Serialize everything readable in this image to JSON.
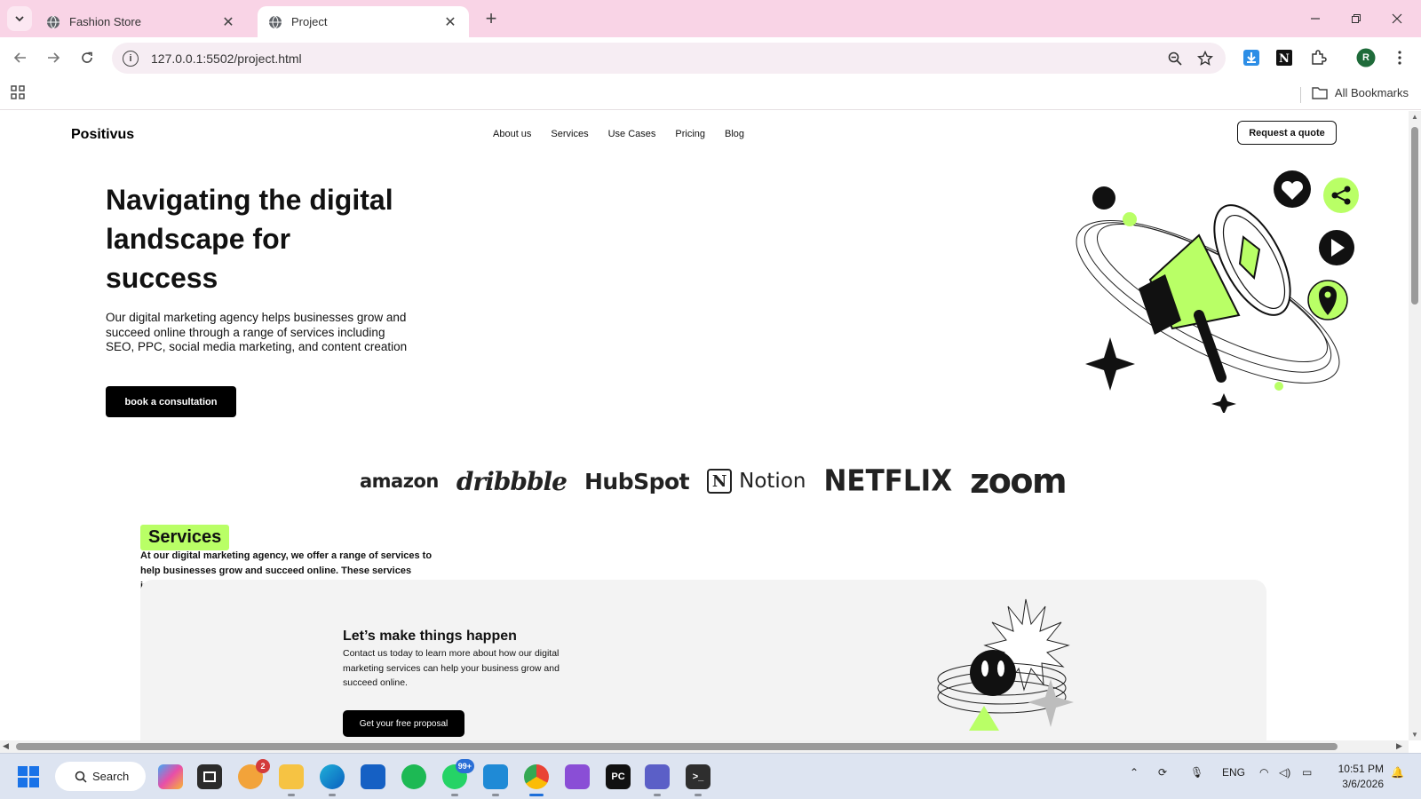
{
  "browser": {
    "tabs": [
      {
        "title": "Fashion Store",
        "active": false
      },
      {
        "title": "Project",
        "active": true
      }
    ],
    "url": "127.0.0.1:5502/project.html",
    "bookmarks_label": "All Bookmarks",
    "profile_initial": "R"
  },
  "site": {
    "logo": "Positivus",
    "nav": [
      "About us",
      "Services",
      "Use Cases",
      "Pricing",
      "Blog"
    ],
    "quote_button": "Request a quote",
    "hero": {
      "title": "Navigating the digital landscape for success",
      "description": "Our digital marketing agency helps businesses grow and succeed online through a range of services including SEO, PPC, social media marketing, and content creation",
      "cta": "book a consultation"
    },
    "partner_logos": [
      "amazon",
      "dribbble",
      "HubSpot",
      "Notion",
      "NETFLIX",
      "zoom"
    ],
    "services": {
      "tag": "Services",
      "description": "At our digital marketing agency, we offer a range of services to help businesses grow and succeed online. These services include:"
    },
    "cta_block": {
      "title": "Let’s make things happen",
      "text": "Contact us today to learn more about how our digital marketing services can help your business grow and succeed online.",
      "button": "Get your free proposal"
    },
    "accent_color": "#b9ff66"
  },
  "taskbar": {
    "search_label": "Search",
    "apps": [
      {
        "name": "copilot",
        "badge": ""
      },
      {
        "name": "task-view",
        "badge": ""
      },
      {
        "name": "weather",
        "badge": "2"
      },
      {
        "name": "file-explorer",
        "badge": ""
      },
      {
        "name": "edge",
        "badge": ""
      },
      {
        "name": "microsoft-store",
        "badge": ""
      },
      {
        "name": "spotify",
        "badge": ""
      },
      {
        "name": "whatsapp",
        "badge": "99+"
      },
      {
        "name": "vscode",
        "badge": ""
      },
      {
        "name": "chrome",
        "badge": ""
      },
      {
        "name": "visual-studio",
        "badge": ""
      },
      {
        "name": "pycharm",
        "badge": ""
      },
      {
        "name": "teams",
        "badge": ""
      },
      {
        "name": "terminal",
        "badge": ""
      }
    ],
    "language": "ENG",
    "time": "10:51 PM",
    "date": "3/6/2026"
  }
}
